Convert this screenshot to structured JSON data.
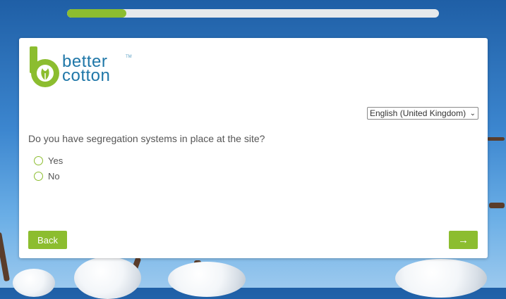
{
  "progress": {
    "fraction": 0.16
  },
  "brand": {
    "line1": "better",
    "line2": "cotton",
    "tm": "TM"
  },
  "language": {
    "selected": "English (United Kingdom)"
  },
  "question": {
    "text": "Do you have segregation systems in place at the site?",
    "options": [
      "Yes",
      "No"
    ]
  },
  "nav": {
    "back_label": "Back",
    "next_label": "→"
  },
  "colors": {
    "accent": "#8cbd2f",
    "brand_blue": "#1f77a8"
  }
}
